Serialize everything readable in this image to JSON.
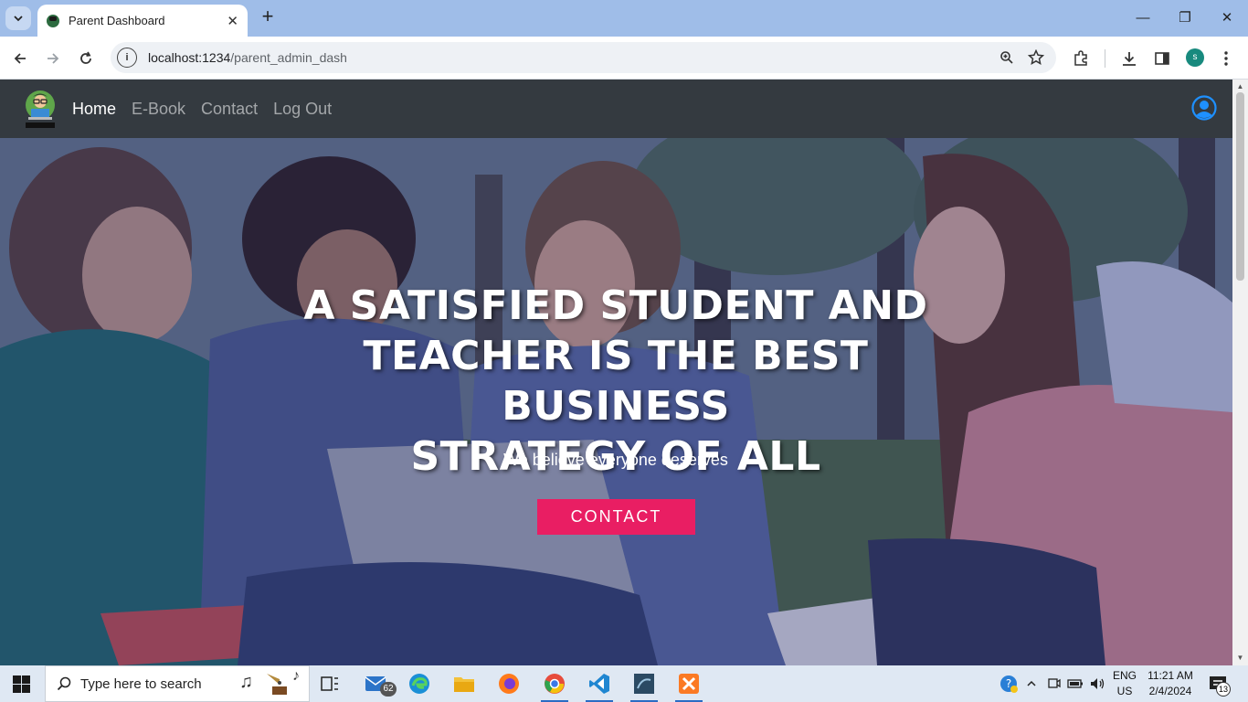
{
  "browser": {
    "tab_title": "Parent Dashboard",
    "tab_close": "✕",
    "new_tab": "+",
    "url": "localhost:1234/parent_admin_dash",
    "window": {
      "minimize": "—",
      "restore": "❐",
      "close": "✕"
    },
    "profile_initial": "s"
  },
  "navbar": {
    "links": [
      {
        "label": "Home",
        "active": true
      },
      {
        "label": "E-Book",
        "active": false
      },
      {
        "label": "Contact",
        "active": false
      },
      {
        "label": "Log Out",
        "active": false
      }
    ]
  },
  "hero": {
    "title_line1": "A SATISFIED STUDENT AND",
    "title_line2": "TEACHER IS THE BEST BUSINESS",
    "title_line3": "STRATEGY OF ALL",
    "subtitle": "We believe everyone deserves",
    "button_label": "CONTACT"
  },
  "taskbar": {
    "search_placeholder": "Type here to search",
    "mail_badge": "62",
    "language": "ENG",
    "region": "US",
    "time": "11:21 AM",
    "date": "2/4/2024",
    "notifications": "13"
  },
  "colors": {
    "navbar_bg": "#343a40",
    "accent_button": "#e91e63",
    "user_icon": "#1e90ff",
    "tabstrip": "#9fbde8"
  }
}
